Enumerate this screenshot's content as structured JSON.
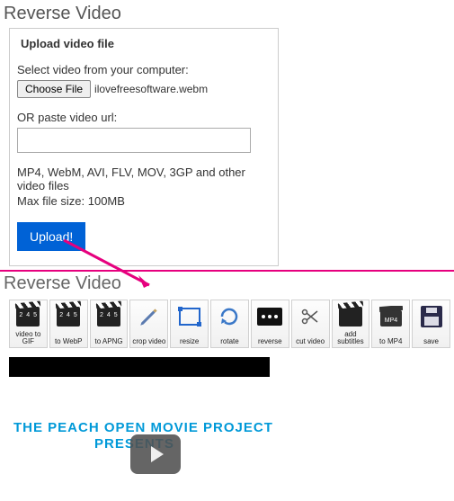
{
  "header": {
    "title": "Reverse Video"
  },
  "upload": {
    "legend": "Upload video file",
    "select_label": "Select video from your computer:",
    "choose_button": "Choose File",
    "file_name": "ilovefreesoftware.webm",
    "or_label": "OR paste video url:",
    "url_value": "",
    "formats": "MP4, WebM, AVI, FLV, MOV, 3GP and other video files",
    "maxsize": "Max file size: 100MB",
    "upload_button": "Upload!"
  },
  "second_header": {
    "title": "Reverse Video"
  },
  "tools": [
    {
      "label": "video to GIF"
    },
    {
      "label": "to WebP"
    },
    {
      "label": "to APNG"
    },
    {
      "label": "crop video"
    },
    {
      "label": "resize"
    },
    {
      "label": "rotate"
    },
    {
      "label": "reverse"
    },
    {
      "label": "cut video"
    },
    {
      "label": "add subtitles"
    },
    {
      "label": "to MP4"
    },
    {
      "label": "save"
    }
  ],
  "preview": {
    "line1": "THE PEACH OPEN MOVIE PROJECT",
    "line2": "PRESENTS"
  }
}
